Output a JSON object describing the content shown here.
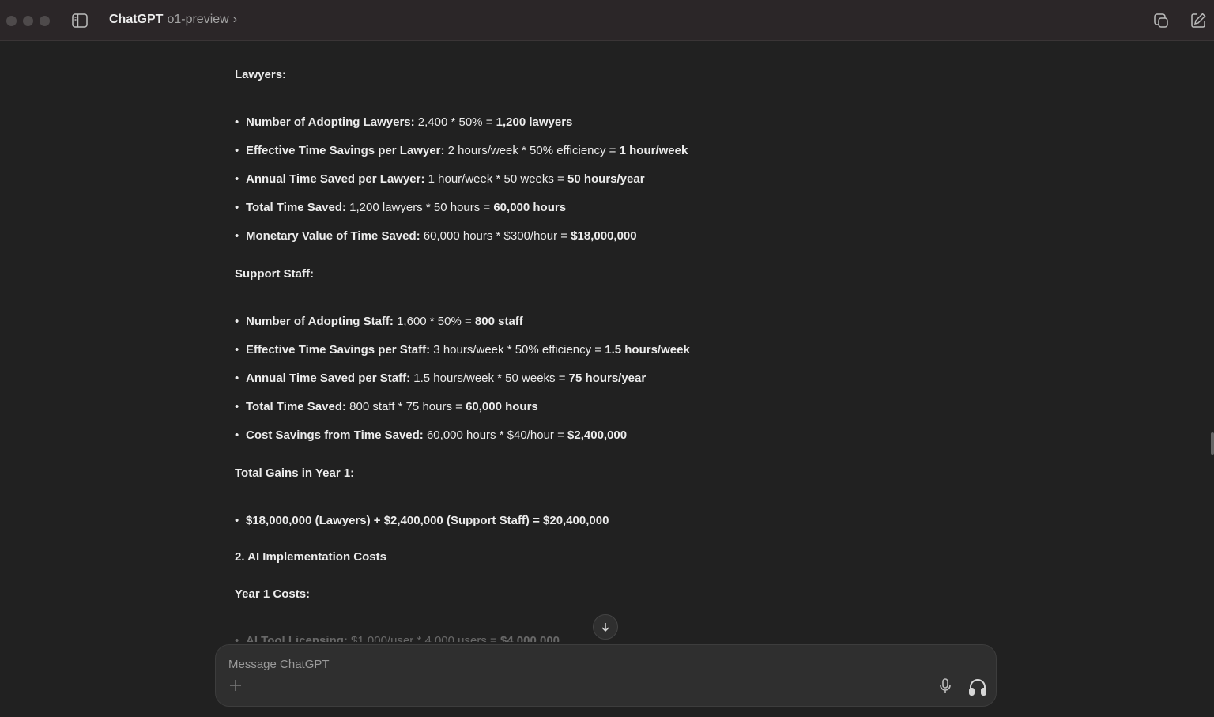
{
  "titlebar": {
    "app_name": "ChatGPT",
    "model": "o1-preview",
    "chevron": "›"
  },
  "content": {
    "lawyers_heading": "Lawyers:",
    "lawyers": [
      {
        "label": "Number of Adopting Lawyers:",
        "text": " 2,400 * 50% = ",
        "result": "1,200 lawyers"
      },
      {
        "label": "Effective Time Savings per Lawyer:",
        "text": " 2 hours/week * 50% efficiency = ",
        "result": "1 hour/week"
      },
      {
        "label": "Annual Time Saved per Lawyer:",
        "text": " 1 hour/week * 50 weeks = ",
        "result": "50 hours/year"
      },
      {
        "label": "Total Time Saved:",
        "text": " 1,200 lawyers * 50 hours = ",
        "result": "60,000 hours"
      },
      {
        "label": "Monetary Value of Time Saved:",
        "text": " 60,000 hours * $300/hour = ",
        "result": "$18,000,000"
      }
    ],
    "staff_heading": "Support Staff:",
    "staff": [
      {
        "label": "Number of Adopting Staff:",
        "text": " 1,600 * 50% = ",
        "result": "800 staff"
      },
      {
        "label": "Effective Time Savings per Staff:",
        "text": " 3 hours/week * 50% efficiency = ",
        "result": "1.5 hours/week"
      },
      {
        "label": "Annual Time Saved per Staff:",
        "text": " 1.5 hours/week * 50 weeks = ",
        "result": "75 hours/year"
      },
      {
        "label": "Total Time Saved:",
        "text": " 800 staff * 75 hours = ",
        "result": "60,000 hours"
      },
      {
        "label": "Cost Savings from Time Saved:",
        "text": " 60,000 hours * $40/hour = ",
        "result": "$2,400,000"
      }
    ],
    "total_heading": "Total Gains in Year 1:",
    "total_line": "$18,000,000 (Lawyers) + $2,400,000 (Support Staff) = $20,400,000",
    "section2_heading": "2. AI Implementation Costs",
    "year1_heading": "Year 1 Costs:",
    "faded_bullet": {
      "label": "AI Tool Licensing:",
      "text": " $1,000/user * 4,000 users = ",
      "result": "$4,000,000"
    }
  },
  "composer": {
    "placeholder": "Message ChatGPT"
  },
  "icons": {
    "sidebar": "sidebar-toggle-icon",
    "copy": "new-window-icon",
    "edit": "compose-icon",
    "scroll": "arrow-down-icon",
    "plus": "plus-icon",
    "mic": "microphone-icon",
    "voice": "headphones-icon"
  },
  "colors": {
    "background": "#212121",
    "titlebar": "#2b2628",
    "text": "#ececec",
    "muted": "#9b9b9b"
  }
}
